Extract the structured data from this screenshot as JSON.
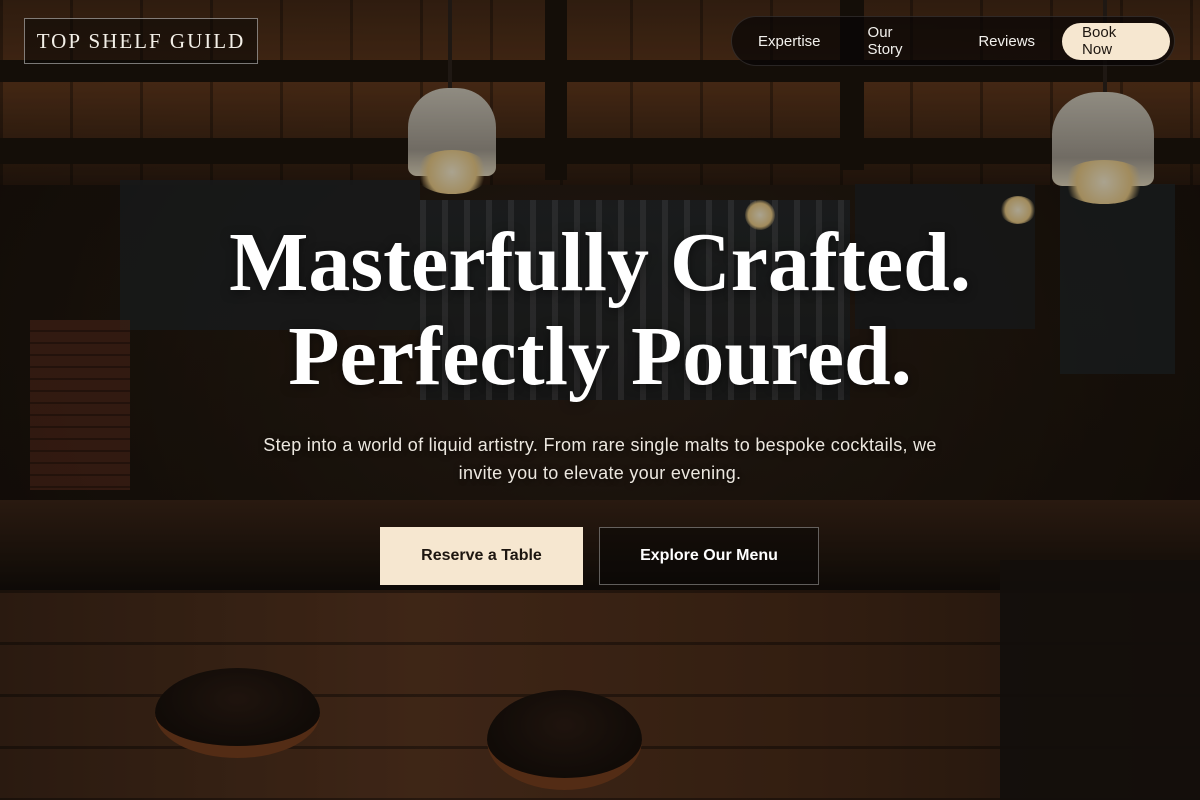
{
  "brand": {
    "name": "TOP SHELF GUILD"
  },
  "nav": {
    "links": [
      "Expertise",
      "Our Story",
      "Reviews"
    ],
    "cta_label": "Book Now"
  },
  "hero": {
    "title_line1": "Masterfully Crafted.",
    "title_line2": "Perfectly Poured.",
    "subtitle": "Step into a world of liquid artistry. From rare single malts to bespoke cocktails, we invite you to elevate your evening.",
    "primary_cta": "Reserve a Table",
    "secondary_cta": "Explore Our Menu"
  },
  "colors": {
    "accent": "#f6e7d0",
    "nav_background": "#080605",
    "text": "#ffffff"
  }
}
